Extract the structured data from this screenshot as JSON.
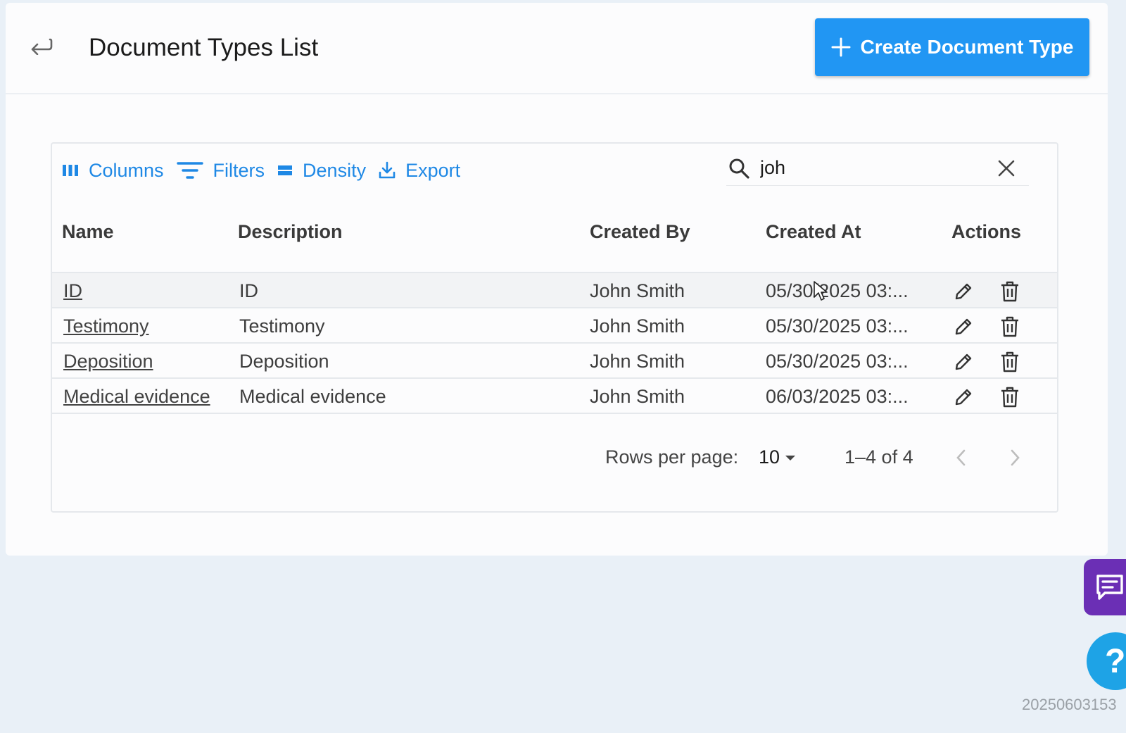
{
  "header": {
    "title": "Document Types List",
    "create_label": "Create Document Type"
  },
  "toolbar": {
    "columns_label": "Columns",
    "filters_label": "Filters",
    "density_label": "Density",
    "export_label": "Export"
  },
  "search": {
    "value": "joh"
  },
  "table": {
    "columns": [
      "Name",
      "Description",
      "Created By",
      "Created At",
      "Actions"
    ],
    "rows": [
      {
        "name": "ID",
        "description": "ID",
        "created_by": "John Smith",
        "created_at": "05/30/2025 03:..."
      },
      {
        "name": "Testimony",
        "description": "Testimony",
        "created_by": "John Smith",
        "created_at": "05/30/2025 03:..."
      },
      {
        "name": "Deposition",
        "description": "Deposition",
        "created_by": "John Smith",
        "created_at": "05/30/2025 03:..."
      },
      {
        "name": "Medical evidence",
        "description": "Medical evidence",
        "created_by": "John Smith",
        "created_at": "06/03/2025 03:..."
      }
    ]
  },
  "pagination": {
    "rows_per_page_label": "Rows per page:",
    "rows_per_page": "10",
    "range": "1–4 of 4"
  },
  "version": "20250603153",
  "help_label": "?",
  "colors": {
    "primary": "#2196f3",
    "link": "#1e88e5",
    "chat": "#6b2fb5",
    "help": "#1ea3e6"
  }
}
